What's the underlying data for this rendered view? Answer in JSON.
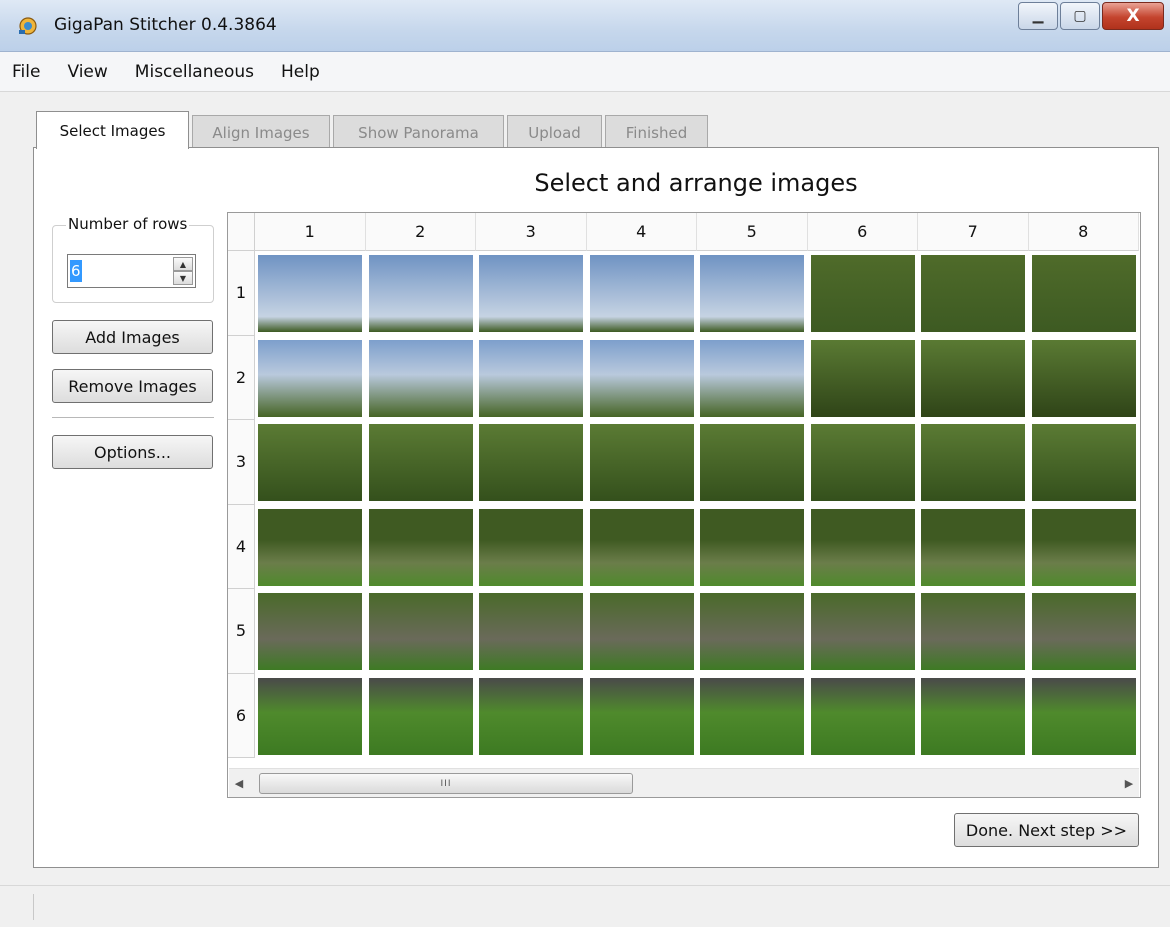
{
  "window": {
    "title": "GigaPan Stitcher 0.4.3864",
    "minimize": "▁",
    "maximize": "▢",
    "close": "X"
  },
  "menu": [
    "File",
    "View",
    "Miscellaneous",
    "Help"
  ],
  "tabs": [
    {
      "label": "Select Images",
      "active": true
    },
    {
      "label": "Align Images",
      "active": false
    },
    {
      "label": "Show Panorama",
      "active": false
    },
    {
      "label": "Upload",
      "active": false
    },
    {
      "label": "Finished",
      "active": false
    }
  ],
  "heading": "Select and arrange images",
  "rows_group": {
    "label": "Number of rows",
    "value": "6"
  },
  "buttons": {
    "add": "Add Images",
    "remove": "Remove Images",
    "options": "Options...",
    "next": "Done.  Next step >>"
  },
  "grid": {
    "columns": [
      "1",
      "2",
      "3",
      "4",
      "5",
      "6",
      "7",
      "8"
    ],
    "rows": [
      "1",
      "2",
      "3",
      "4",
      "5",
      "6"
    ]
  },
  "scroll": {
    "thumb_label": "III",
    "left_arrow": "◀",
    "right_arrow": "▶"
  },
  "colors": {
    "sky_top": "#6f93c3",
    "sky_bottom": "#c6d3e3",
    "foliage": "#4f6b2a",
    "grass": "#4f8a2c",
    "accent_red": "#cc2222"
  }
}
